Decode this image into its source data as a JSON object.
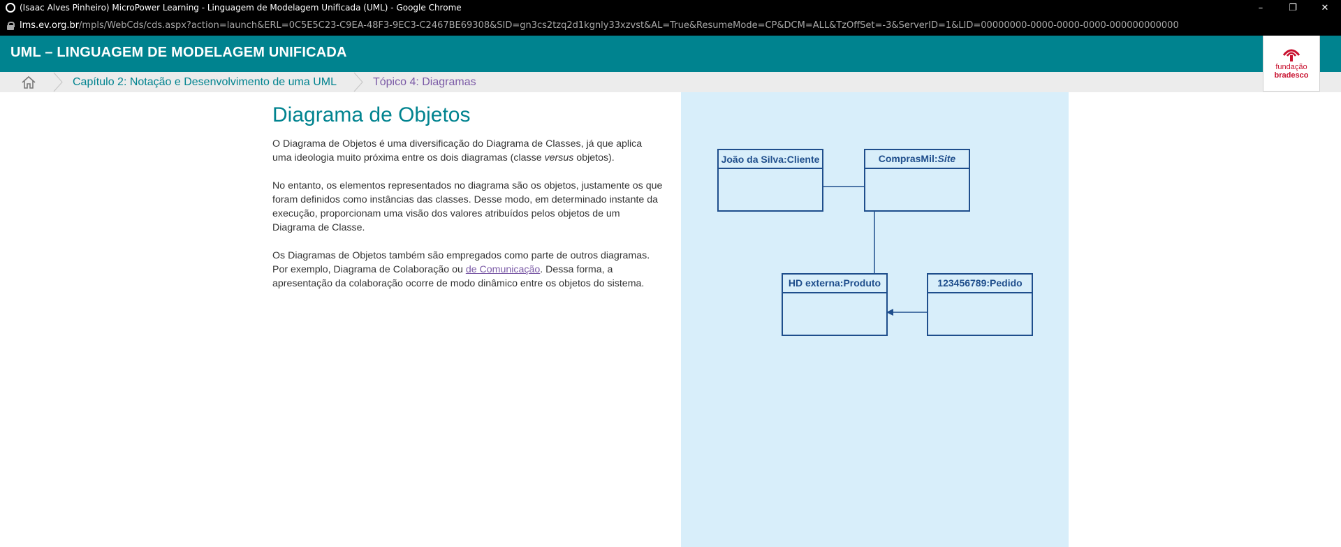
{
  "browser": {
    "window_title": "(Isaac Alves Pinheiro) MicroPower Learning - Linguagem de Modelagem Unificada (UML) - Google Chrome",
    "url_host": "lms.ev.org.br",
    "url_path": "/mpls/WebCds/cds.aspx?action=launch&ERL=0C5E5C23-C9EA-48F3-9EC3-C2467BE69308&SID=gn3cs2tzq2d1kgnly33xzvst&AL=True&ResumeMode=CP&DCM=ALL&TzOffSet=-3&ServerID=1&LID=00000000-0000-0000-0000-000000000000",
    "minimize_label": "–",
    "restore_label": "❐",
    "close_label": "✕"
  },
  "header": {
    "course_title": "UML – LINGUAGEM DE MODELAGEM UNIFICADA",
    "logo_line1": "fundação",
    "logo_line2": "bradesco"
  },
  "breadcrumbs": {
    "chapter": "Capítulo 2: Notação e Desenvolvimento de uma UML",
    "topic": "Tópico 4: Diagramas"
  },
  "content": {
    "heading": "Diagrama de Objetos",
    "p1_before": "O Diagrama de Objetos é uma diversificação do Diagrama de Classes, já que aplica uma ideologia muito próxima entre os dois diagramas (classe ",
    "p1_em": "versus",
    "p1_after": " objetos).",
    "p2": "No entanto, os elementos representados no diagrama são os objetos, justamente os que foram definidos como instâncias das classes. Desse modo, em determinado instante da execução, proporcionam uma visão dos valores atribuídos pelos objetos de um Diagrama de Classe.",
    "p3_before": "Os Diagramas de Objetos também são empregados como parte de outros diagramas. Por exemplo, Diagrama de Colaboração ou ",
    "p3_link": "de Comunicação",
    "p3_after": ". Dessa forma, a apresentação da colaboração ocorre de modo dinâmico entre os objetos do sistema."
  },
  "diagram": {
    "obj1": "João da Silva:Cliente",
    "obj2_prefix": "ComprasMil:",
    "obj2_italic": "Site",
    "obj3": "HD externa:Produto",
    "obj4": "123456789:Pedido"
  }
}
